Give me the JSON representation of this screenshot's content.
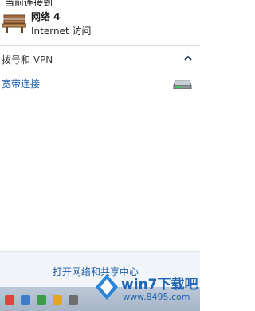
{
  "network": {
    "name": "网络  4",
    "status": "Internet 访问"
  },
  "dialup": {
    "section_title": "拨号和 VPN",
    "connection_label": "宽带连接"
  },
  "footer": {
    "link_label": "打开网络和共享中心"
  },
  "watermark": {
    "brand": "win7下载吧",
    "url": "www.8495.com"
  },
  "colors": {
    "link": "#1f5ea8",
    "footer_bg": "#f1f4f8",
    "taskbar": "#b0bfd0"
  }
}
